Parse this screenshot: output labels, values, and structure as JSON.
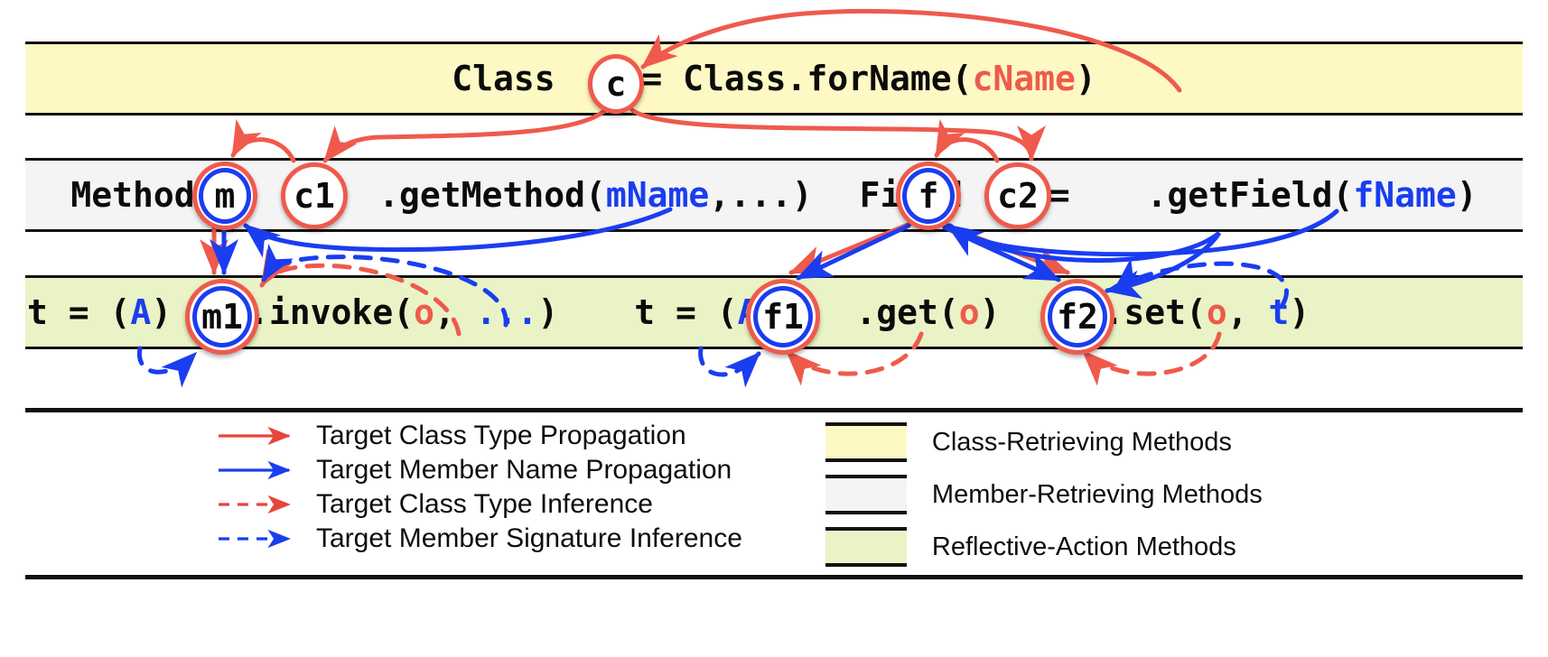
{
  "rows": [
    {
      "id": "class-retrieving",
      "band_color": "#FDF8C4",
      "segments": [
        {
          "t": "Class ",
          "c": "black"
        },
        {
          "t": "c",
          "c": "node"
        },
        {
          "t": " = Class.forName(",
          "c": "black"
        },
        {
          "t": "cName",
          "c": "red"
        },
        {
          "t": ")",
          "c": "black"
        }
      ],
      "text": "Class c = Class.forName(cName)"
    },
    {
      "id": "member-retrieving",
      "band_color": "#F4F4F4",
      "segments": [
        {
          "t": "Method ",
          "c": "black"
        },
        {
          "t": "m",
          "c": "node"
        },
        {
          "t": " = ",
          "c": "black"
        },
        {
          "t": "c1",
          "c": "node"
        },
        {
          "t": ".getMethod(",
          "c": "black"
        },
        {
          "t": "mName",
          "c": "blue"
        },
        {
          "t": ",...)",
          "c": "black"
        },
        {
          "t": "   Field ",
          "c": "black"
        },
        {
          "t": "f",
          "c": "node"
        },
        {
          "t": " = ",
          "c": "black"
        },
        {
          "t": "c2",
          "c": "node"
        },
        {
          "t": ".getField(",
          "c": "black"
        },
        {
          "t": "fName",
          "c": "blue"
        },
        {
          "t": ")",
          "c": "black"
        }
      ],
      "text": "Method m = c1.getMethod(mName,...)  Field f = c2.getField(fName)"
    },
    {
      "id": "reflective-action",
      "band_color": "#EAF3C6",
      "segments": [
        {
          "t": "t = (",
          "c": "black"
        },
        {
          "t": "A",
          "c": "blue"
        },
        {
          "t": ") ",
          "c": "black"
        },
        {
          "t": "m1",
          "c": "node"
        },
        {
          "t": ".invoke(",
          "c": "black"
        },
        {
          "t": "o",
          "c": "red"
        },
        {
          "t": ", ",
          "c": "black"
        },
        {
          "t": "...",
          "c": "blue"
        },
        {
          "t": ")",
          "c": "black"
        },
        {
          "t": "   t = (",
          "c": "black"
        },
        {
          "t": "A",
          "c": "blue"
        },
        {
          "t": ") ",
          "c": "black"
        },
        {
          "t": "f1",
          "c": "node"
        },
        {
          "t": ".get(",
          "c": "black"
        },
        {
          "t": "o",
          "c": "red"
        },
        {
          "t": ")   ",
          "c": "black"
        },
        {
          "t": "f2",
          "c": "node"
        },
        {
          "t": ".set(",
          "c": "black"
        },
        {
          "t": "o",
          "c": "red"
        },
        {
          "t": ", ",
          "c": "black"
        },
        {
          "t": "t",
          "c": "blue"
        },
        {
          "t": ")",
          "c": "black"
        }
      ],
      "text": "t = (A) m1.invoke(o, ...)    t = (A) f1.get(o)   f2.set(o, t)"
    }
  ],
  "code": {
    "row1": {
      "pre": "Class ",
      "node": "c",
      "mid": " = Class.forName(",
      "arg": "cName",
      "post": ")"
    },
    "row2": {
      "method_pre": "Method ",
      "method_node": "m",
      "eq": " = ",
      "c1_node": "c1",
      "method_call": ".getMethod(",
      "mname": "mName",
      "method_post": ",...)",
      "field_pre": "Field ",
      "field_node": "f",
      "c2_node": "c2",
      "field_call": ".getField(",
      "fname": "fName",
      "field_post": ")"
    },
    "row3": {
      "invoke_pre": "t = (",
      "invoke_cast": "A",
      "invoke_mid": ") ",
      "m1_node": "m1",
      "invoke_call": ".invoke(",
      "invoke_o": "o",
      "invoke_comma": ", ",
      "invoke_dots": "...",
      "invoke_post": ")",
      "get_pre": "t = (",
      "get_cast": "A",
      "get_mid": ") ",
      "f1_node": "f1",
      "get_call": ".get(",
      "get_o": "o",
      "get_post": ")",
      "f2_node": "f2",
      "set_call": ".set(",
      "set_o": "o",
      "set_comma": ", ",
      "set_t": "t",
      "set_post": ")"
    }
  },
  "nodes": [
    {
      "id": "c",
      "label": "c",
      "outer": "red",
      "inner": null
    },
    {
      "id": "m",
      "label": "m",
      "outer": "red",
      "inner": "blue"
    },
    {
      "id": "c1",
      "label": "c1",
      "outer": "red",
      "inner": null
    },
    {
      "id": "f",
      "label": "f",
      "outer": "red",
      "inner": "blue"
    },
    {
      "id": "c2",
      "label": "c2",
      "outer": "red",
      "inner": null
    },
    {
      "id": "m1",
      "label": "m1",
      "outer": "red",
      "inner": "blue"
    },
    {
      "id": "f1",
      "label": "f1",
      "outer": "red",
      "inner": "blue"
    },
    {
      "id": "f2",
      "label": "f2",
      "outer": "red",
      "inner": "blue"
    }
  ],
  "legend": {
    "lines": [
      {
        "id": "target-class-type-propagation",
        "label": "Target Class Type Propagation",
        "color": "#E8453C",
        "style": "solid"
      },
      {
        "id": "target-member-name-propagation",
        "label": "Target Member Name Propagation",
        "color": "#1A3DF0",
        "style": "solid"
      },
      {
        "id": "target-class-type-inference",
        "label": "Target Class Type Inference",
        "color": "#E8453C",
        "style": "dashed"
      },
      {
        "id": "target-member-signature-inference",
        "label": "Target Member Signature Inference",
        "color": "#1A3DF0",
        "style": "dashed"
      }
    ],
    "bands": [
      {
        "id": "class-retrieving-methods",
        "label": "Class-Retrieving Methods",
        "color": "#FDF8C4"
      },
      {
        "id": "member-retrieving-methods",
        "label": "Member-Retrieving Methods",
        "color": "#F4F4F4"
      },
      {
        "id": "reflective-action-methods",
        "label": "Reflective-Action Methods",
        "color": "#EAF3C6"
      }
    ]
  },
  "colors": {
    "red": "#EF5A4C",
    "blue": "#1A3DF0",
    "yellow_band": "#FDF8C4",
    "gray_band": "#F4F4F4",
    "green_band": "#EAF3C6",
    "rule": "#111111"
  }
}
